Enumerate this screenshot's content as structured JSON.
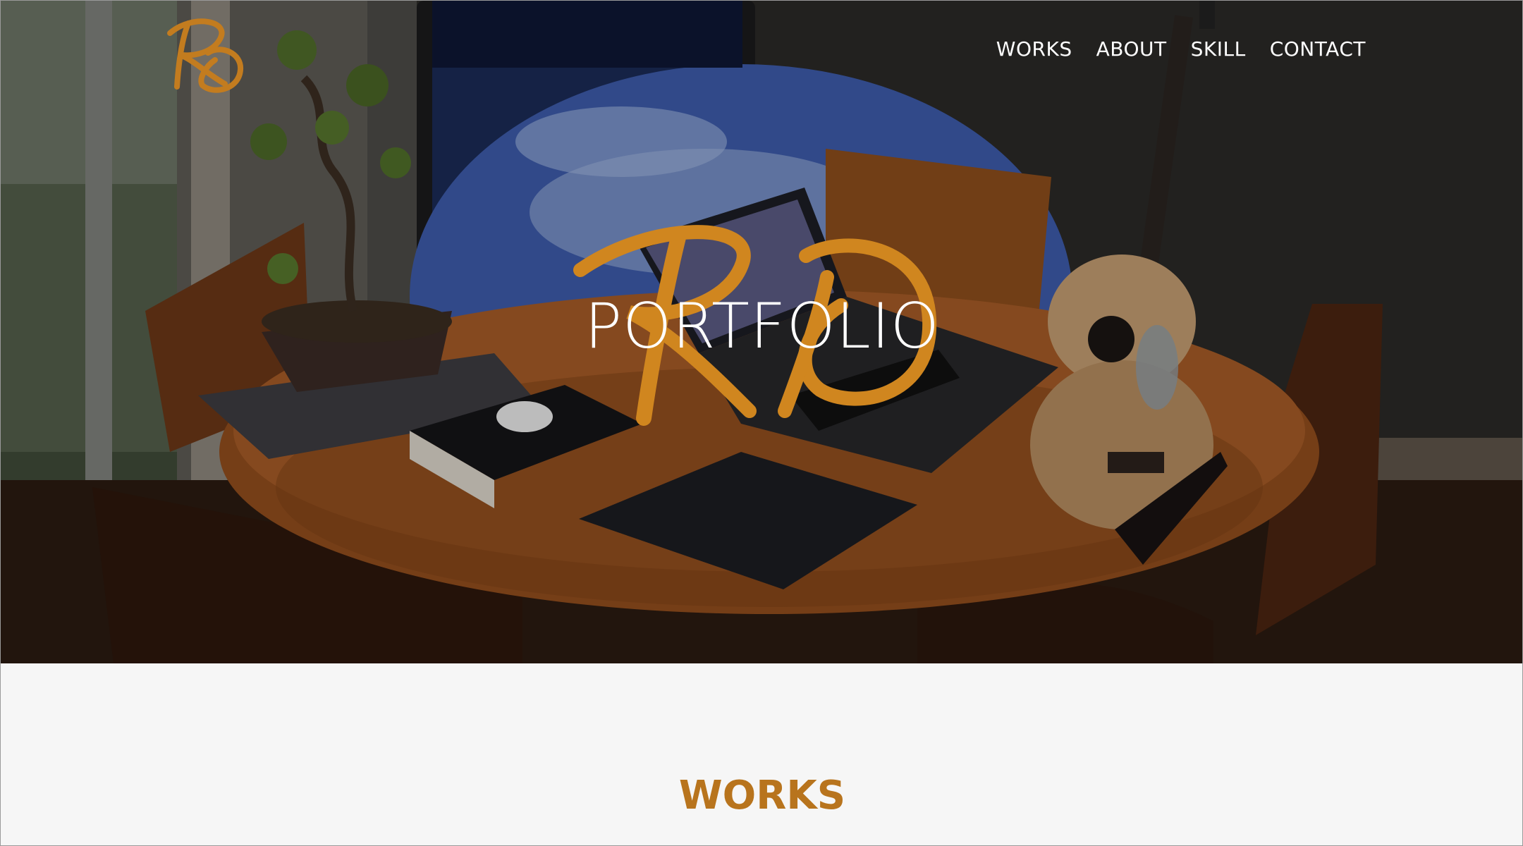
{
  "header": {
    "logo_text": "RD",
    "nav": [
      "WORKS",
      "ABOUT",
      "SKILL",
      "CONTACT"
    ]
  },
  "hero": {
    "logo_text": "RD",
    "title": "PORTFOLIO"
  },
  "works": {
    "heading": "WORKS"
  },
  "colors": {
    "accent": "#b8741d",
    "nav_text": "#ffffff",
    "section_bg": "#f6f6f6"
  }
}
